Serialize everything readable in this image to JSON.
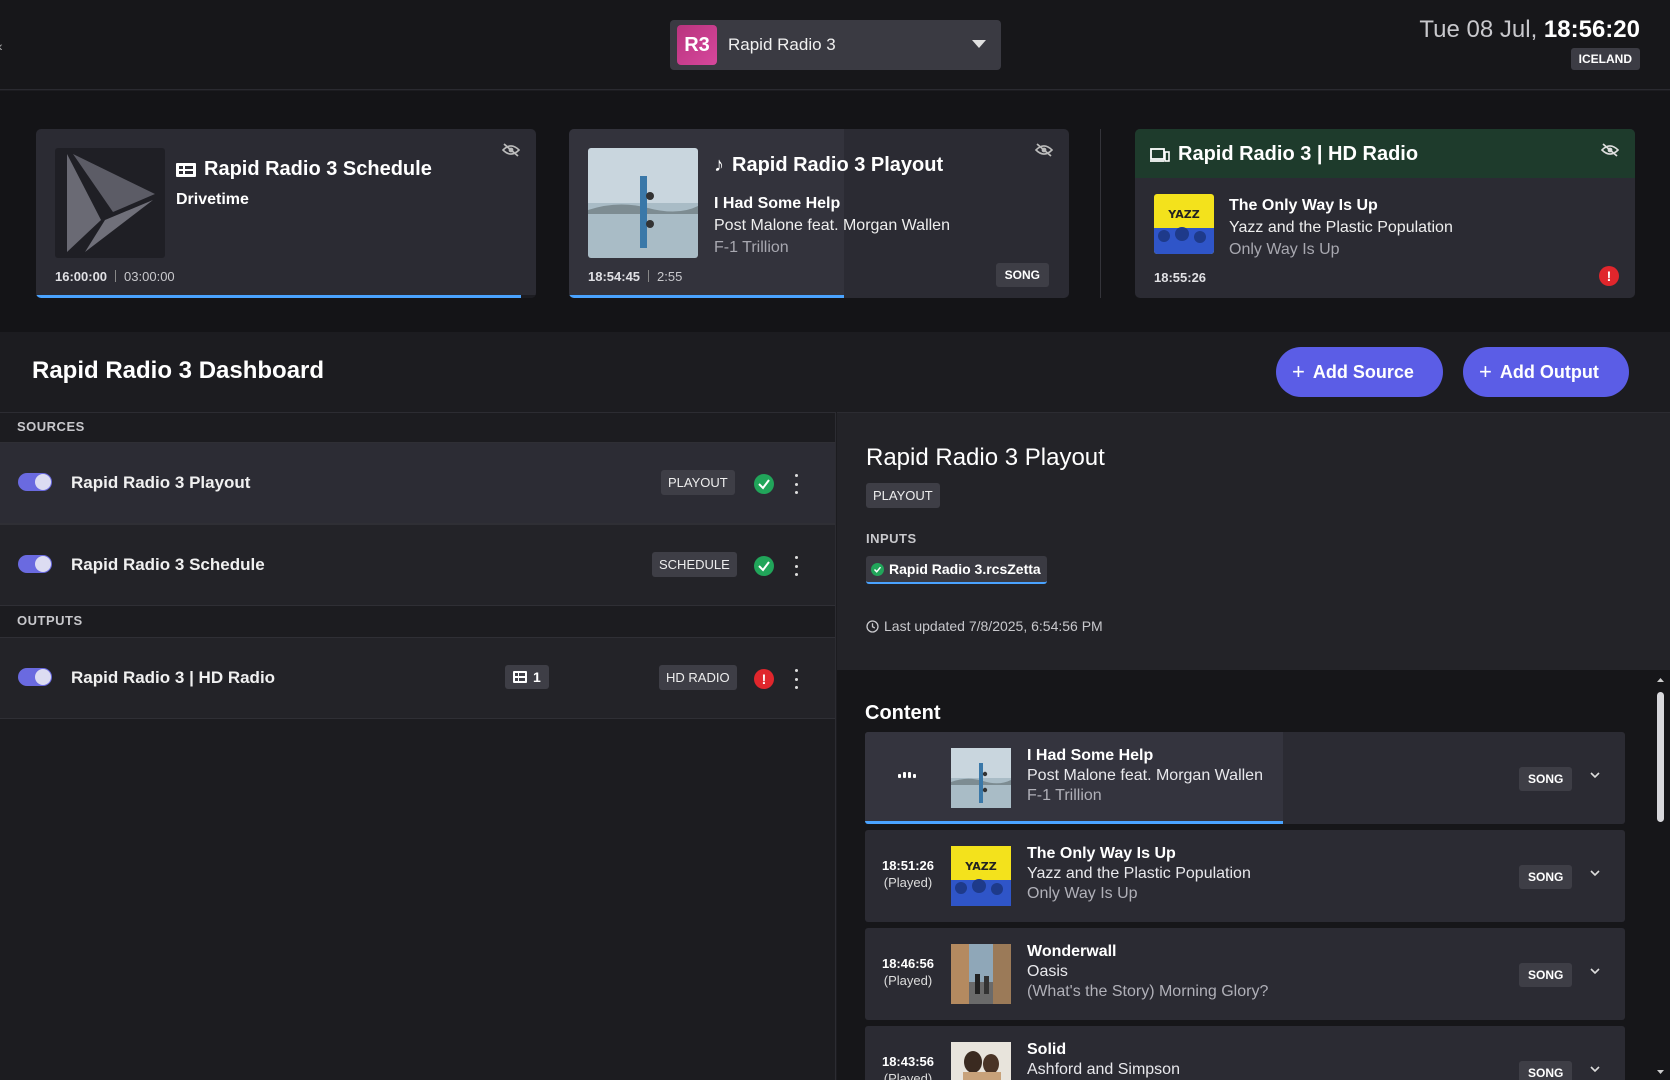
{
  "topbar": {
    "station_logo": "R3",
    "station_name": "Rapid Radio 3",
    "date": "Tue 08 Jul, ",
    "time": "18:56:20",
    "region": "ICELAND"
  },
  "cards": {
    "schedule": {
      "title": "Rapid Radio 3 Schedule",
      "subtitle": "Drivetime",
      "start": "16:00:00",
      "duration": "03:00:00",
      "progress": 0.97
    },
    "playout": {
      "title": "Rapid Radio 3 Playout",
      "song": "I Had Some Help",
      "artist": "Post Malone feat. Morgan Wallen",
      "album": "F-1 Trillion",
      "start": "18:54:45",
      "duration": "2:55",
      "badge": "SONG",
      "progress": 0.55
    },
    "hdradio": {
      "title": "Rapid Radio 3 | HD Radio",
      "song": "The Only Way Is Up",
      "artist": "Yazz and the Plastic Population",
      "album": "Only Way Is Up",
      "start": "18:55:26",
      "alert": "!"
    }
  },
  "dashboard": {
    "title": "Rapid Radio 3 Dashboard",
    "add_source": "Add Source",
    "add_output": "Add Output"
  },
  "left": {
    "sources_label": "SOURCES",
    "outputs_label": "OUTPUTS",
    "sources": [
      {
        "name": "Rapid Radio 3 Playout",
        "type": "PLAYOUT"
      },
      {
        "name": "Rapid Radio 3 Schedule",
        "type": "SCHEDULE"
      }
    ],
    "outputs": [
      {
        "name": "Rapid Radio 3 | HD Radio",
        "type": "HD RADIO",
        "count": "1",
        "alert": "!"
      }
    ]
  },
  "detail": {
    "title": "Rapid Radio 3 Playout",
    "badge": "PLAYOUT",
    "inputs_label": "INPUTS",
    "input_name": "Rapid Radio 3.rcsZetta",
    "updated": "Last updated 7/8/2025, 6:54:56 PM"
  },
  "content": {
    "title": "Content",
    "items": [
      {
        "time": "",
        "status": "",
        "title": "I Had Some Help",
        "artist": "Post Malone feat. Morgan Wallen",
        "album": "F-1 Trillion",
        "badge": "SONG",
        "progress": 0.55
      },
      {
        "time": "18:51:26",
        "status": "(Played)",
        "title": "The Only Way Is Up",
        "artist": "Yazz and the Plastic Population",
        "album": "Only Way Is Up",
        "badge": "SONG"
      },
      {
        "time": "18:46:56",
        "status": "(Played)",
        "title": "Wonderwall",
        "artist": "Oasis",
        "album": "(What's the Story) Morning Glory?",
        "badge": "SONG"
      },
      {
        "time": "18:43:56",
        "status": "(Played)",
        "title": "Solid",
        "artist": "Ashford and Simpson",
        "album": "",
        "badge": "SONG"
      }
    ]
  },
  "colors": {
    "accent": "#5b5de6",
    "progress": "#4aa3ff",
    "ok": "#21a55a",
    "error": "#e0262c",
    "hd_header": "#1e3b2c"
  }
}
